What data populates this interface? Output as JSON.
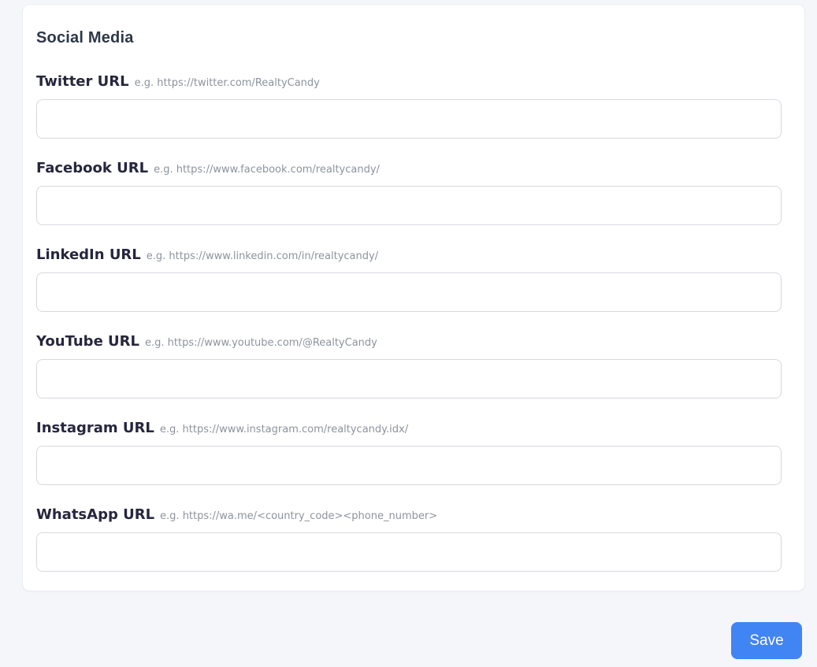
{
  "page": {
    "background": "#f5f6fa"
  },
  "section": {
    "title": "Social Media"
  },
  "fields": [
    {
      "name": "twitter",
      "label": "Twitter URL",
      "hint": "e.g. https://twitter.com/RealtyCandy",
      "value": ""
    },
    {
      "name": "facebook",
      "label": "Facebook URL",
      "hint": "e.g. https://www.facebook.com/realtycandy/",
      "value": ""
    },
    {
      "name": "linkedin",
      "label": "LinkedIn URL",
      "hint": "e.g. https://www.linkedin.com/in/realtycandy/",
      "value": ""
    },
    {
      "name": "youtube",
      "label": "YouTube URL",
      "hint": "e.g. https://www.youtube.com/@RealtyCandy",
      "value": ""
    },
    {
      "name": "instagram",
      "label": "Instagram URL",
      "hint": "e.g. https://www.instagram.com/realtycandy.idx/",
      "value": ""
    },
    {
      "name": "whatsapp",
      "label": "WhatsApp URL",
      "hint": "e.g. https://wa.me/<country_code><phone_number>",
      "value": ""
    }
  ],
  "actions": {
    "save_label": "Save"
  },
  "colors": {
    "accent_blue": "#4184f4",
    "card_background": "#ffffff",
    "label_text": "#26263e",
    "hint_text": "#8d939e",
    "input_border": "#d7d9e0"
  }
}
